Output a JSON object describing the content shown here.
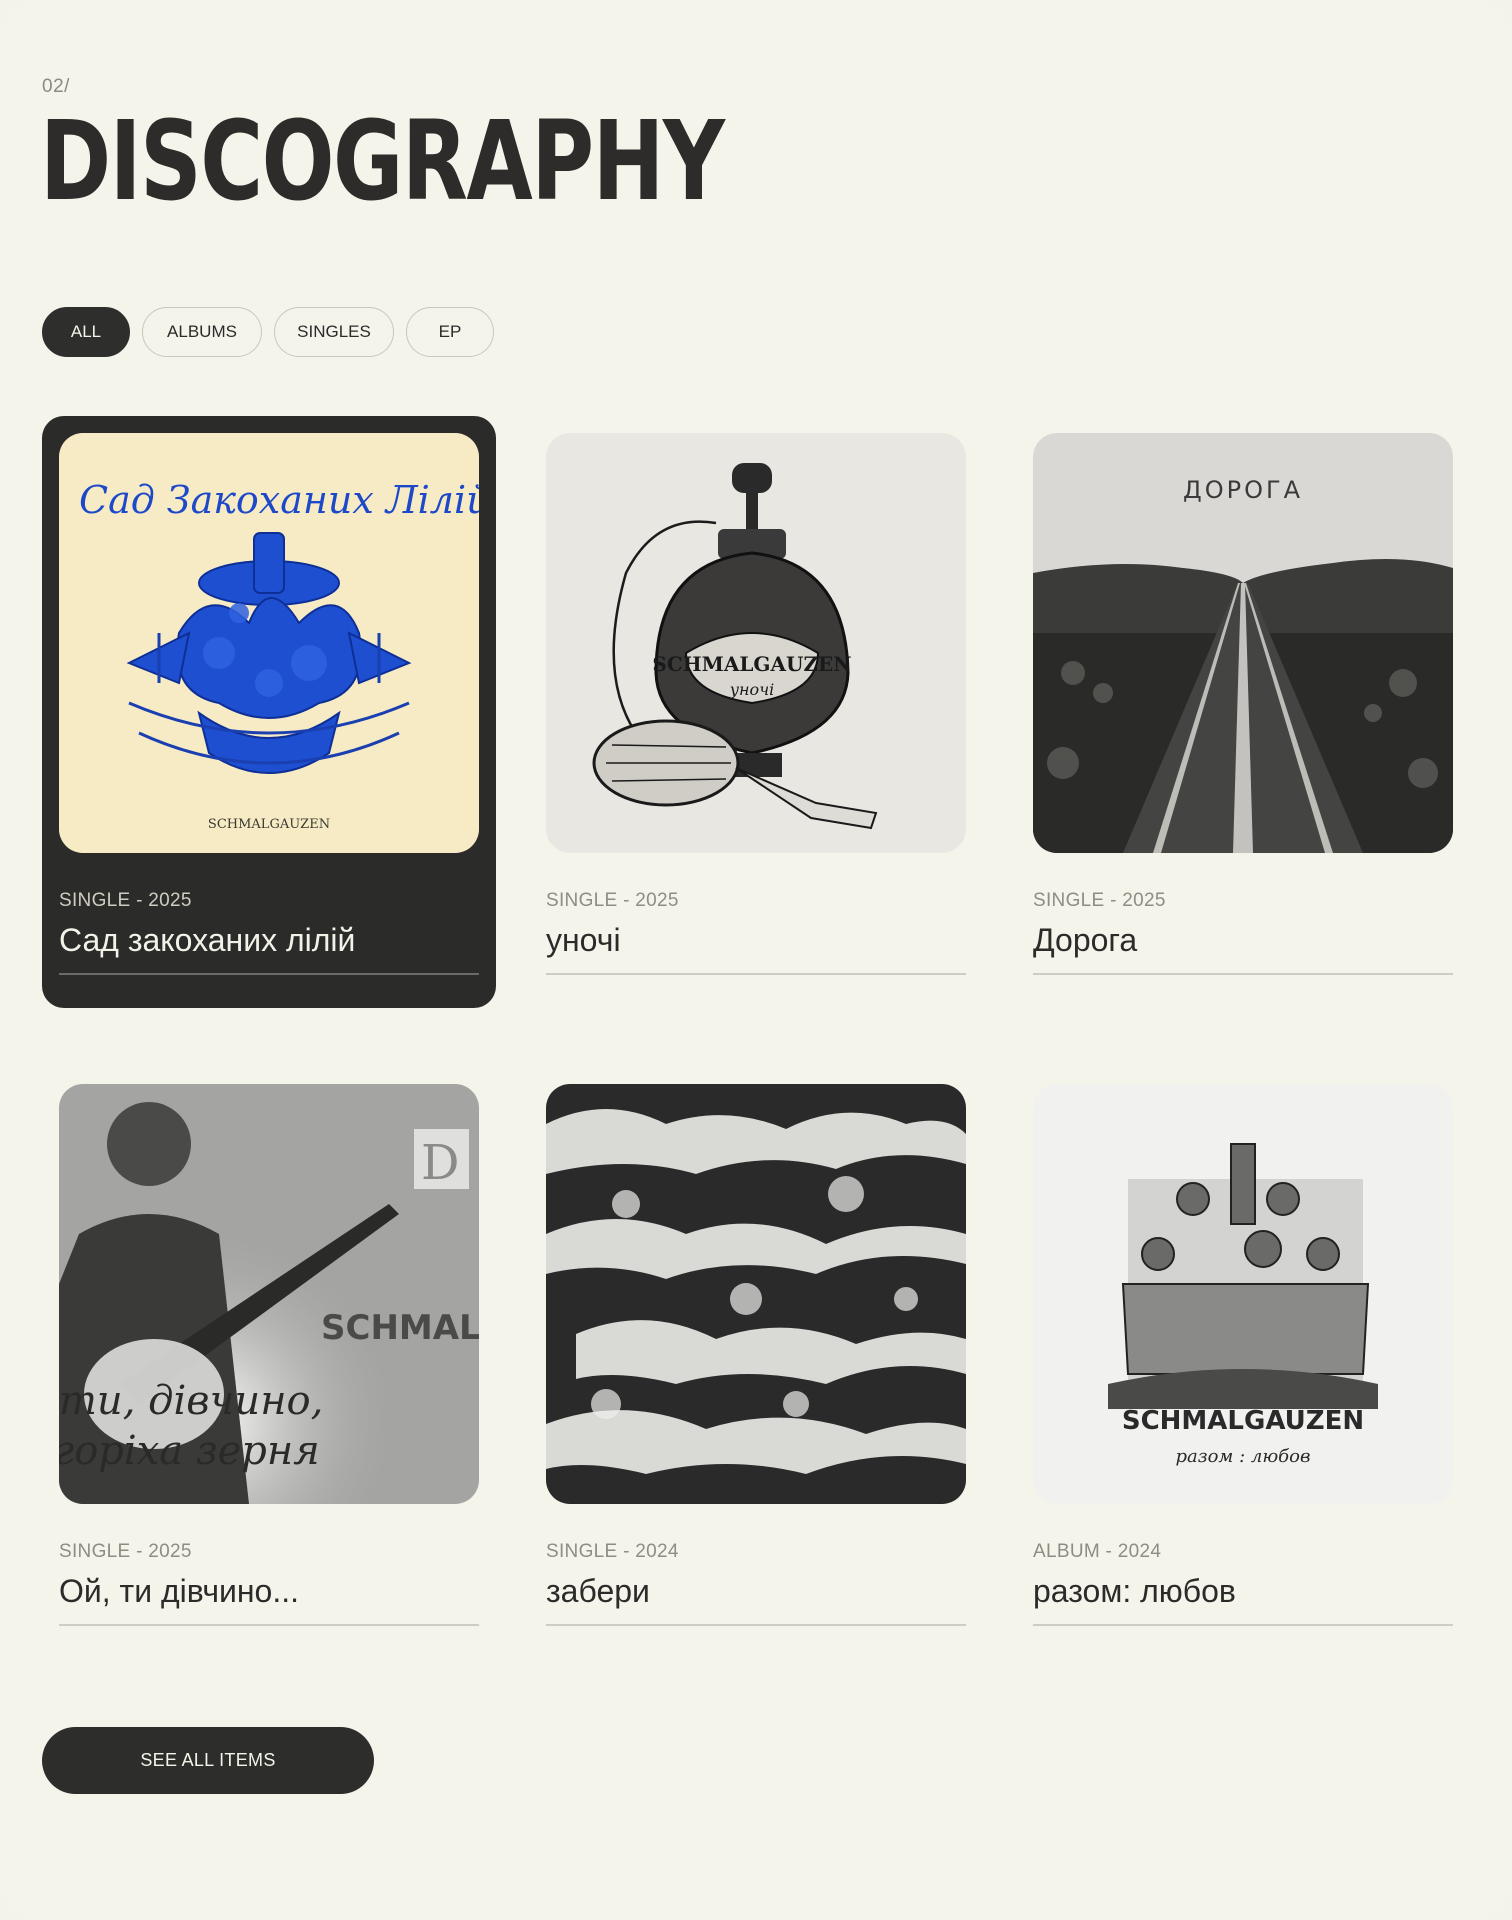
{
  "header": {
    "section_number": "02/",
    "title": "DISCOGRAPHY"
  },
  "filters": [
    {
      "label": "ALL",
      "active": true
    },
    {
      "label": "ALBUMS",
      "active": false
    },
    {
      "label": "SINGLES",
      "active": false
    },
    {
      "label": "EP",
      "active": false
    }
  ],
  "releases": [
    {
      "meta": "SINGLE - 2025",
      "title": "Сад закоханих лілій",
      "active": true,
      "cover": {
        "handwriting": "Сад Закоханих Лілій",
        "artist": "SCHMALGAUZEN"
      }
    },
    {
      "meta": "SINGLE - 2025",
      "title": "уночі",
      "active": false,
      "cover": {
        "artist": "SCHMALGAUZEN",
        "subtitle": "уночі"
      }
    },
    {
      "meta": "SINGLE - 2025",
      "title": "Дорога",
      "active": false,
      "cover": {
        "caption": "ДОРОГА"
      }
    },
    {
      "meta": "SINGLE - 2025",
      "title": "Ой, ти дівчино...",
      "active": false,
      "cover": {
        "artist": "SCHMALG",
        "line1": "ти, дівчино,",
        "line2": "горіха зерня",
        "corner": "D"
      }
    },
    {
      "meta": "SINGLE - 2024",
      "title": "забери",
      "active": false,
      "cover": {}
    },
    {
      "meta": "ALBUM - 2024",
      "title": "разом: любов",
      "active": false,
      "cover": {
        "artist": "SCHMALGAUZEN",
        "subtitle": "разом : любов"
      }
    }
  ],
  "see_all_label": "SEE ALL ITEMS",
  "colors": {
    "background": "#f5f4ea",
    "dark": "#2b2b29",
    "accent_blue": "#1f4fd1"
  }
}
